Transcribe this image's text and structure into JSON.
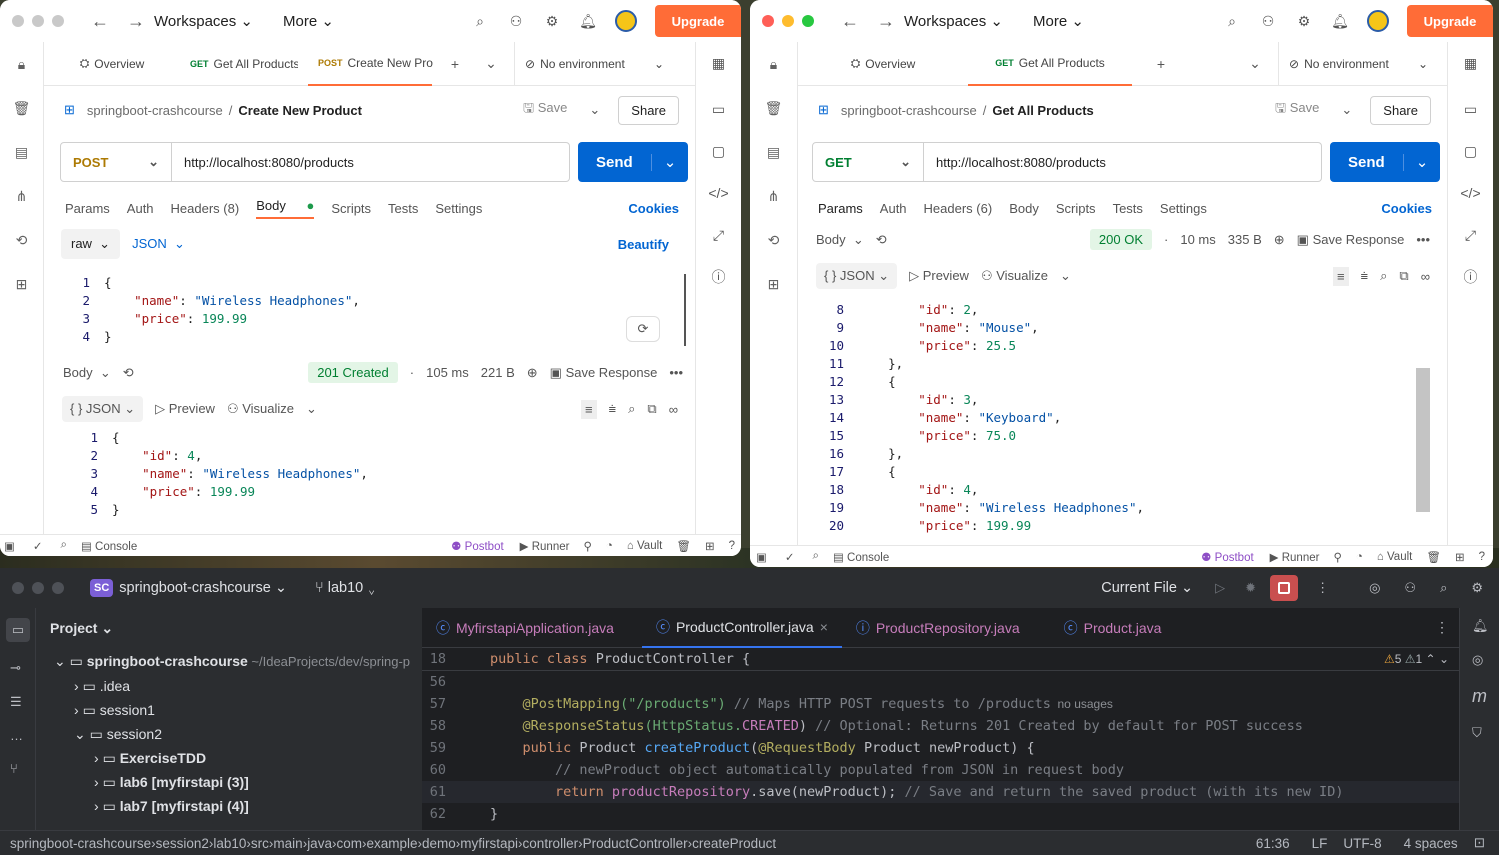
{
  "postman_left": {
    "nav": {
      "workspaces": "Workspaces",
      "more": "More",
      "upgrade": "Upgrade"
    },
    "tabs": {
      "overview": "Overview",
      "tab1_method": "GET",
      "tab1_label": "Get All Products",
      "tab2_method": "POST",
      "tab2_label": "Create New Pro",
      "environment": "No environment"
    },
    "breadcrumb": {
      "collection": "springboot-crashcourse",
      "separator": "/",
      "request": "Create New Product",
      "save": "Save",
      "share": "Share"
    },
    "request": {
      "method": "POST",
      "url": "http://localhost:8080/products",
      "send": "Send"
    },
    "req_tabs": [
      "Params",
      "Auth",
      "Headers (8)",
      "Body",
      "Scripts",
      "Tests",
      "Settings"
    ],
    "cookies": "Cookies",
    "body_mode": "raw",
    "body_lang": "JSON",
    "beautify": "Beautify",
    "request_body": [
      {
        "n": "1",
        "t": "{"
      },
      {
        "n": "2",
        "key": "\"name\"",
        "val": "\"Wireless Headphones\"",
        "tail": ","
      },
      {
        "n": "3",
        "key": "\"price\"",
        "num": "199.99"
      },
      {
        "n": "4",
        "t": "}"
      }
    ],
    "response": {
      "label": "Body",
      "status": "201 Created",
      "time": "105 ms",
      "size": "221 B",
      "save_response": "Save Response",
      "format": "{ } JSON",
      "preview": "Preview",
      "visualize": "Visualize"
    },
    "response_body": [
      {
        "n": "1",
        "t": "{"
      },
      {
        "n": "2",
        "key": "\"id\"",
        "num": "4",
        "tail": ","
      },
      {
        "n": "3",
        "key": "\"name\"",
        "val": "\"Wireless Headphones\"",
        "tail": ","
      },
      {
        "n": "4",
        "key": "\"price\"",
        "num": "199.99"
      },
      {
        "n": "5",
        "t": "}"
      }
    ],
    "status": {
      "console": "Console",
      "postbot": "Postbot",
      "runner": "Runner",
      "vault": "Vault"
    }
  },
  "postman_right": {
    "nav": {
      "workspaces": "Workspaces",
      "more": "More",
      "upgrade": "Upgrade"
    },
    "tabs": {
      "overview": "Overview",
      "tab1_method": "GET",
      "tab1_label": "Get All Products",
      "environment": "No environment"
    },
    "breadcrumb": {
      "collection": "springboot-crashcourse",
      "separator": "/",
      "request": "Get All Products",
      "save": "Save",
      "share": "Share"
    },
    "request": {
      "method": "GET",
      "url": "http://localhost:8080/products",
      "send": "Send"
    },
    "req_tabs": [
      "Params",
      "Auth",
      "Headers (6)",
      "Body",
      "Scripts",
      "Tests",
      "Settings"
    ],
    "cookies": "Cookies",
    "response": {
      "label": "Body",
      "status": "200 OK",
      "time": "10 ms",
      "size": "335 B",
      "save_response": "Save Response",
      "format": "{ } JSON",
      "preview": "Preview",
      "visualize": "Visualize"
    },
    "response_body": [
      {
        "n": "8",
        "key": "\"id\"",
        "num": "2",
        "tail": ",",
        "ind": 2
      },
      {
        "n": "9",
        "key": "\"name\"",
        "val": "\"Mouse\"",
        "tail": ",",
        "ind": 2
      },
      {
        "n": "10",
        "key": "\"price\"",
        "num": "25.5",
        "ind": 2
      },
      {
        "n": "11",
        "t": "},",
        "ind": 1
      },
      {
        "n": "12",
        "t": "{",
        "ind": 1
      },
      {
        "n": "13",
        "key": "\"id\"",
        "num": "3",
        "tail": ",",
        "ind": 2
      },
      {
        "n": "14",
        "key": "\"name\"",
        "val": "\"Keyboard\"",
        "tail": ",",
        "ind": 2
      },
      {
        "n": "15",
        "key": "\"price\"",
        "num": "75.0",
        "ind": 2
      },
      {
        "n": "16",
        "t": "},",
        "ind": 1
      },
      {
        "n": "17",
        "t": "{",
        "ind": 1
      },
      {
        "n": "18",
        "key": "\"id\"",
        "num": "4",
        "tail": ",",
        "ind": 2
      },
      {
        "n": "19",
        "key": "\"name\"",
        "val": "\"Wireless Headphones\"",
        "tail": ",",
        "ind": 2
      },
      {
        "n": "20",
        "key": "\"price\"",
        "num": "199.99",
        "ind": 2
      }
    ],
    "status": {
      "console": "Console",
      "postbot": "Postbot",
      "runner": "Runner",
      "vault": "Vault"
    }
  },
  "intellij": {
    "project_badge": "SC",
    "project_name": "springboot-crashcourse",
    "branch": "lab10",
    "run_config": "Current File",
    "project_panel_title": "Project",
    "tree": [
      {
        "label": "springboot-crashcourse",
        "path": "~/IdeaProjects/dev/spring-p",
        "level": 0,
        "open": true,
        "bold": true
      },
      {
        "label": ".idea",
        "level": 1,
        "open": false
      },
      {
        "label": "session1",
        "level": 1,
        "open": false
      },
      {
        "label": "session2",
        "level": 1,
        "open": true
      },
      {
        "label": "ExerciseTDD",
        "level": 2,
        "open": false,
        "bold": true
      },
      {
        "label": "lab6 [myfirstapi (3)]",
        "level": 2,
        "open": false,
        "bold": true
      },
      {
        "label": "lab7 [myfirstapi (4)]",
        "level": 2,
        "open": false,
        "bold": true
      }
    ],
    "editor_tabs": [
      "MyfirstapiApplication.java",
      "ProductController.java",
      "ProductRepository.java",
      "Product.java"
    ],
    "active_tab": 1,
    "sticky_line": {
      "n": "18",
      "kw": "public class",
      "name": "ProductController",
      "tail": "{"
    },
    "warnings": "5",
    "weak_warnings": "1",
    "code": [
      {
        "n": "56",
        "html": ""
      },
      {
        "n": "57",
        "ann": "@PostMapping",
        "args": "(\"/products\")",
        "cmt": " // Maps HTTP POST requests to /products",
        "hint": "  no usages"
      },
      {
        "n": "58",
        "ann": "@ResponseStatus",
        "args": "(HttpStatus.",
        "konst": "CREATED",
        "args2": ")",
        "cmt": " // Optional: Returns 201 Created by default for POST success"
      },
      {
        "n": "59",
        "kw": "public",
        "plain": " Product ",
        "fn": "createProduct",
        "p2": "(",
        "ann2": "@RequestBody",
        "plain2": " Product newProduct) {"
      },
      {
        "n": "60",
        "cmt2": "    // newProduct object automatically populated from JSON in request body"
      },
      {
        "n": "61",
        "kw2": "    return",
        "field": " productRepository",
        "plain3": ".save(newProduct);",
        "cmt3": " // Save and return the saved product (with its new ID)"
      },
      {
        "n": "62",
        "plain4": "}"
      }
    ],
    "statusbar": {
      "crumbs": [
        "springboot-crashcourse",
        "session2",
        "lab10",
        "src",
        "main",
        "java",
        "com",
        "example",
        "demo",
        "myfirstapi",
        "controller",
        "ProductController",
        "createProduct"
      ],
      "position": "61:36",
      "line_sep": "LF",
      "encoding": "UTF-8",
      "indent": "4 spaces"
    }
  },
  "colors": {
    "accent": "#ff6c37",
    "send": "#0265d2",
    "ok_green": "#007f31"
  }
}
